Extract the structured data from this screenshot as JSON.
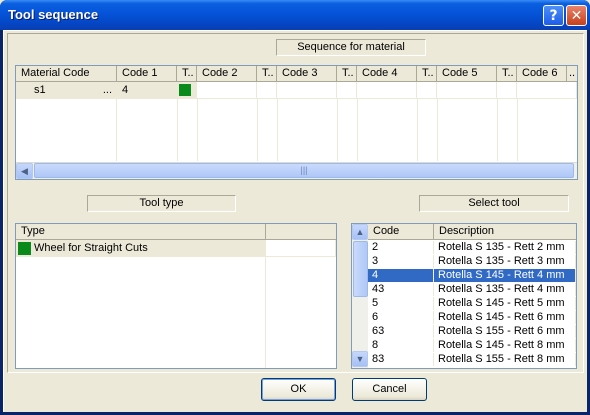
{
  "window": {
    "title": "Tool sequence",
    "help_glyph": "?",
    "close_glyph": "✕"
  },
  "labels": {
    "sequence_for_material": "Sequence for material",
    "tool_type": "Tool type",
    "select_tool": "Select tool"
  },
  "sequence_grid": {
    "headers": [
      "Material Code",
      "Code 1",
      "T..",
      "Code 2",
      "T..",
      "Code 3",
      "T..",
      "Code 4",
      "T..",
      "Code 5",
      "T..",
      "Code 6",
      ".."
    ],
    "rows": [
      {
        "material": "s1",
        "ellipsis": "...",
        "code1": "4",
        "type1_color": "#0a8a1a"
      }
    ]
  },
  "type_grid": {
    "headers": [
      "Type"
    ],
    "rows": [
      {
        "label": "Wheel for Straight Cuts",
        "color": "#0a8a1a"
      }
    ]
  },
  "tool_grid": {
    "headers": [
      "Code",
      "Description"
    ],
    "rows": [
      {
        "code": "2",
        "desc": "Rotella S 135 - Rett 2 mm"
      },
      {
        "code": "3",
        "desc": "Rotella S 135 - Rett 3 mm"
      },
      {
        "code": "4",
        "desc": "Rotella S 145 - Rett 4 mm",
        "selected": true
      },
      {
        "code": "43",
        "desc": "Rotella S 135 - Rett 4 mm"
      },
      {
        "code": "5",
        "desc": "Rotella S 145 - Rett 5 mm"
      },
      {
        "code": "6",
        "desc": "Rotella S 145 - Rett 6 mm"
      },
      {
        "code": "63",
        "desc": "Rotella S 155 - Rett 6 mm"
      },
      {
        "code": "8",
        "desc": "Rotella S 145 - Rett 8 mm"
      },
      {
        "code": "83",
        "desc": "Rotella S 155 - Rett 8 mm"
      }
    ]
  },
  "buttons": {
    "ok": "OK",
    "cancel": "Cancel"
  },
  "icons": {
    "scroll_left": "chevron-left-icon",
    "scroll_up": "chevron-up-icon",
    "scroll_down": "chevron-down-icon"
  }
}
